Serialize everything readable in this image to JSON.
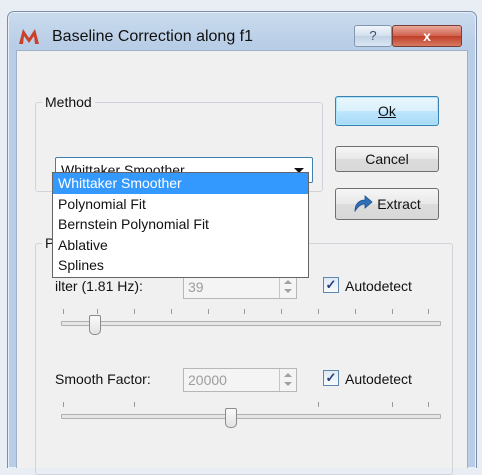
{
  "window": {
    "title": "Baseline Correction along f1",
    "help_label": "?",
    "close_label": "x"
  },
  "method": {
    "group_label": "Method",
    "selected": "Whittaker Smoother",
    "options": [
      "Whittaker Smoother",
      "Polynomial Fit",
      "Bernstein Polynomial Fit",
      "Ablative",
      "Splines"
    ]
  },
  "buttons": {
    "ok": "Ok",
    "cancel": "Cancel",
    "extract": "Extract"
  },
  "params": {
    "group_label_visible": "P",
    "filter_label": "ilter (1.81 Hz):",
    "filter_value": "39",
    "filter_autodetect": "Autodetect",
    "smooth_label": "Smooth Factor:",
    "smooth_value": "20000",
    "smooth_autodetect": "Autodetect",
    "check_mark": "✓"
  },
  "colors": {
    "selection": "#3399ff",
    "close_button": "#c03e28"
  }
}
